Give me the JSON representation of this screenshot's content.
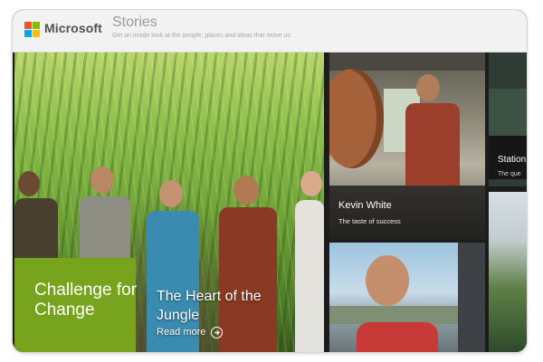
{
  "header": {
    "brand": "Microsoft",
    "title": "Stories",
    "tagline": "Get an inside look at the people, places and ideas that move us"
  },
  "hero": {
    "category": "Challenge for Change",
    "title": "The Heart of the Jungle",
    "link": "Read more"
  },
  "tiles": [
    {
      "title": "Kevin White",
      "subtitle": "The taste of success"
    },
    {
      "title": "Station",
      "subtitle": "The que"
    }
  ],
  "colors": {
    "accent_green": "#77a41c",
    "header_bg": "#f2f2f2",
    "logo_red": "#f35325",
    "logo_green": "#81bc06",
    "logo_blue": "#05a6f0",
    "logo_yellow": "#ffba08"
  },
  "icons": [
    "microsoft-logo-icon",
    "arrow-right-circle-icon"
  ]
}
